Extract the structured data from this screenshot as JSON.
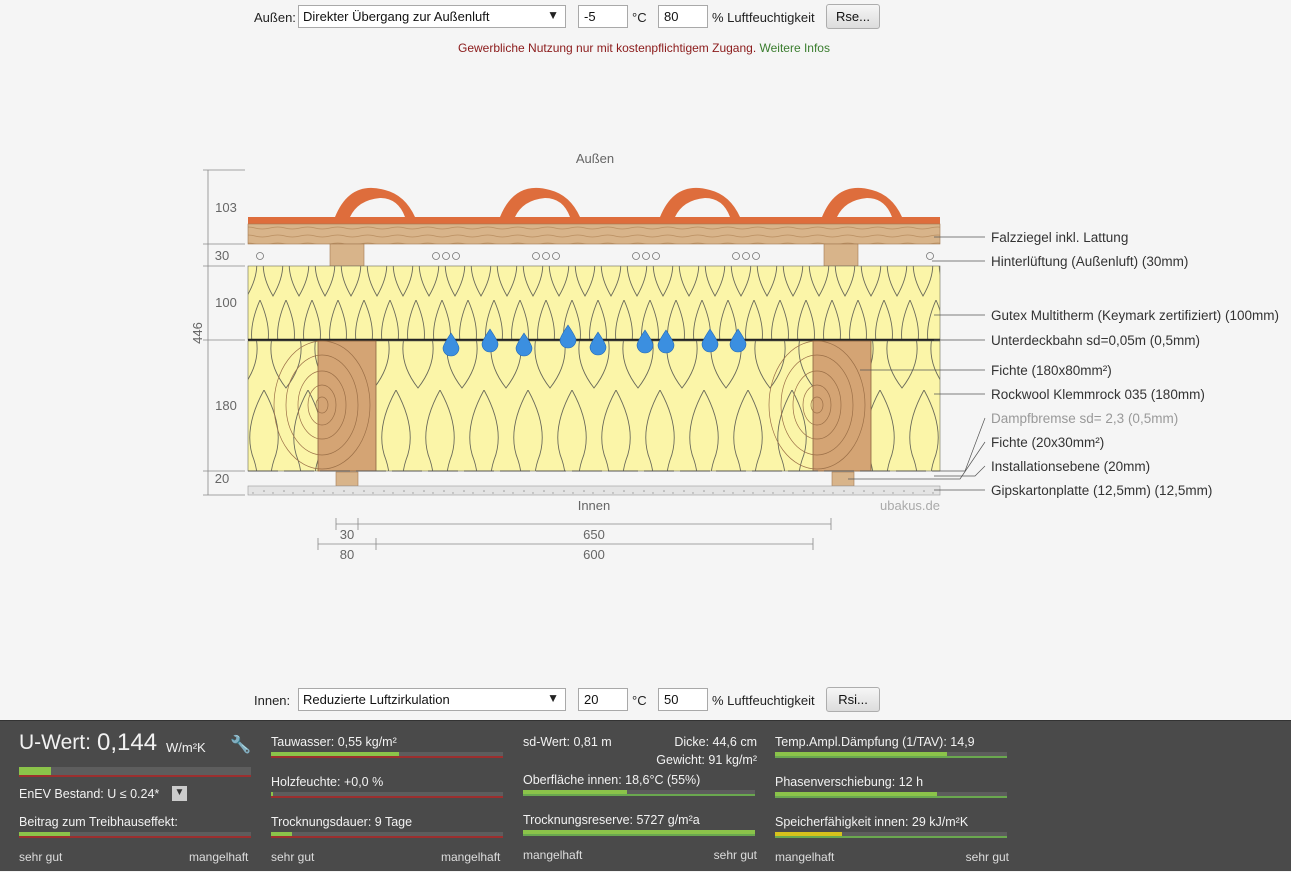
{
  "outside": {
    "label": "Außen:",
    "transfer_select": "Direkter Übergang zur Außenluft",
    "temperature": "-5",
    "temp_unit": "°C",
    "humidity": "80",
    "humidity_label": "% Luftfeuchtigkeit",
    "rs_button": "Rse..."
  },
  "notice": {
    "text": "Gewerbliche Nutzung nur mit kostenpflichtigem Zugang.",
    "link": "Weitere Infos"
  },
  "diagram": {
    "top_label": "Außen",
    "bottom_label": "Innen",
    "watermark": "ubakus.de",
    "dim_total": "446",
    "dims_left": [
      "103",
      "30",
      "100",
      "180",
      "20"
    ],
    "dims_bottom_top": [
      "30",
      "650"
    ],
    "dims_bottom_bottom": [
      "80",
      "600"
    ],
    "layers": [
      {
        "label": "Falzziegel inkl. Lattung",
        "muted": false
      },
      {
        "label": "Hinterlüftung (Außenluft) (30mm)",
        "muted": false
      },
      {
        "label": "Gutex Multitherm  (Keymark zertifiziert) (100mm)",
        "muted": false
      },
      {
        "label": "Unterdeckbahn sd=0,05m (0,5mm)",
        "muted": false
      },
      {
        "label": "Fichte (180x80mm²)",
        "muted": false
      },
      {
        "label": "Rockwool Klemmrock 035 (180mm)",
        "muted": false
      },
      {
        "label": "Dampfbremse sd= 2,3 (0,5mm)",
        "muted": true
      },
      {
        "label": "Fichte (20x30mm²)",
        "muted": false
      },
      {
        "label": "Installationsebene (20mm)",
        "muted": false
      },
      {
        "label": "Gipskartonplatte (12,5mm) (12,5mm)",
        "muted": false
      }
    ]
  },
  "inside": {
    "label": "Innen:",
    "transfer_select": "Reduzierte Luftzirkulation",
    "temperature": "20",
    "temp_unit": "°C",
    "humidity": "50",
    "humidity_label": "% Luftfeuchtigkeit",
    "rs_button": "Rsi..."
  },
  "results": {
    "uwert_label": "U-Wert:",
    "uwert_value": "0,144",
    "uwert_unit": "W/m²K",
    "uwert_fill": 0.14,
    "enev": "EnEV Bestand: U ≤ 0.24*",
    "treibhaus_label": "Beitrag zum Treibhauseffekt:",
    "treibhaus_fill": 0.22,
    "tauwasser": "Tauwasser: 0,55 kg/m²",
    "tauwasser_fill": 0.55,
    "holzfeuchte": "Holzfeuchte: +0,0 %",
    "holzfeuchte_fill": 0.01,
    "trocknungsdauer": "Trocknungsdauer: 9 Tage",
    "trocknungsdauer_fill": 0.09,
    "sdwert": "sd-Wert: 0,81 m",
    "dicke": "Dicke: 44,6 cm",
    "gewicht": "Gewicht: 91 kg/m²",
    "oberflaeche": "Oberfläche innen: 18,6°C (55%)",
    "oberflaeche_fill": 0.45,
    "trocknungsreserve": "Trocknungsreserve: 5727 g/m²a",
    "trocknungsreserve_fill": 1.0,
    "temp_ampl": "Temp.Ampl.Dämpfung (1/TAV): 14,9",
    "temp_ampl_fill": 0.74,
    "phasen": "Phasenverschiebung: 12 h",
    "phasen_fill": 0.7,
    "speicher": "Speicherfähigkeit innen: 29 kJ/m²K",
    "speicher_fill": 0.29,
    "scale_good": "sehr gut",
    "scale_bad": "mangelhaft",
    "scale_bad_first": "mangelhaft",
    "scale_good_last": "sehr gut"
  }
}
